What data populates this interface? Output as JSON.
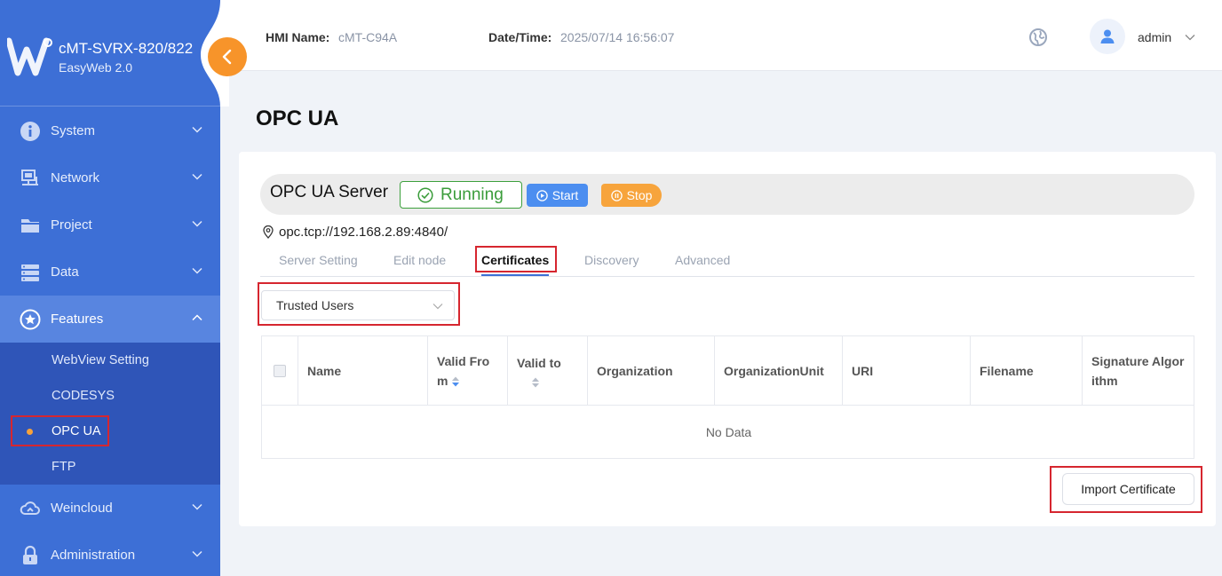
{
  "brand": {
    "title": "cMT-SVRX-820/822",
    "subtitle": "EasyWeb 2.0",
    "logo_icon": "weintek-w-logo"
  },
  "sidebar": {
    "items": [
      {
        "label": "System",
        "icon": "info-icon"
      },
      {
        "label": "Network",
        "icon": "network-icon"
      },
      {
        "label": "Project",
        "icon": "folder-icon"
      },
      {
        "label": "Data",
        "icon": "database-icon"
      },
      {
        "label": "Features",
        "icon": "star-icon"
      },
      {
        "label": "Weincloud",
        "icon": "cloud-icon"
      },
      {
        "label": "Administration",
        "icon": "lock-icon"
      }
    ],
    "features_sub": [
      "WebView Setting",
      "CODESYS",
      "OPC UA",
      "FTP"
    ]
  },
  "header": {
    "hmi_name_label": "HMI Name:",
    "hmi_name_value": "cMT-C94A",
    "datetime_label": "Date/Time:",
    "datetime_value": "2025/07/14 16:56:07",
    "user": "admin"
  },
  "page": {
    "title": "OPC UA"
  },
  "server": {
    "title": "OPC UA Server",
    "status": "Running",
    "start_label": "Start",
    "stop_label": "Stop",
    "endpoint": "opc.tcp://192.168.2.89:4840/"
  },
  "tabs": [
    "Server Setting",
    "Edit node",
    "Certificates",
    "Discovery",
    "Advanced"
  ],
  "active_tab": "Certificates",
  "select": {
    "value": "Trusted Users"
  },
  "table": {
    "columns": [
      "Name",
      "Valid Fro m",
      "Valid to",
      "Organization",
      "OrganizationUnit",
      "URI",
      "Filename",
      "Signature Algorithm"
    ],
    "col_name": "Name",
    "col_valid_from_1": "Valid Fro",
    "col_valid_from_2": "m",
    "col_valid_to": "Valid to",
    "col_org": "Organization",
    "col_org_unit": "OrganizationUnit",
    "col_uri": "URI",
    "col_filename": "Filename",
    "col_sig_1": "Signature Algor",
    "col_sig_2": "ithm",
    "empty_text": "No Data"
  },
  "import_label": "Import Certificate",
  "colors": {
    "sidebar": "#3d6fd6",
    "submenu": "#2f55b8",
    "accent_orange": "#f7942a",
    "running_green": "#3a9c3a",
    "start_blue": "#4c8ef0",
    "stop_orange": "#f7a43c",
    "highlight_red": "#d6262f"
  }
}
